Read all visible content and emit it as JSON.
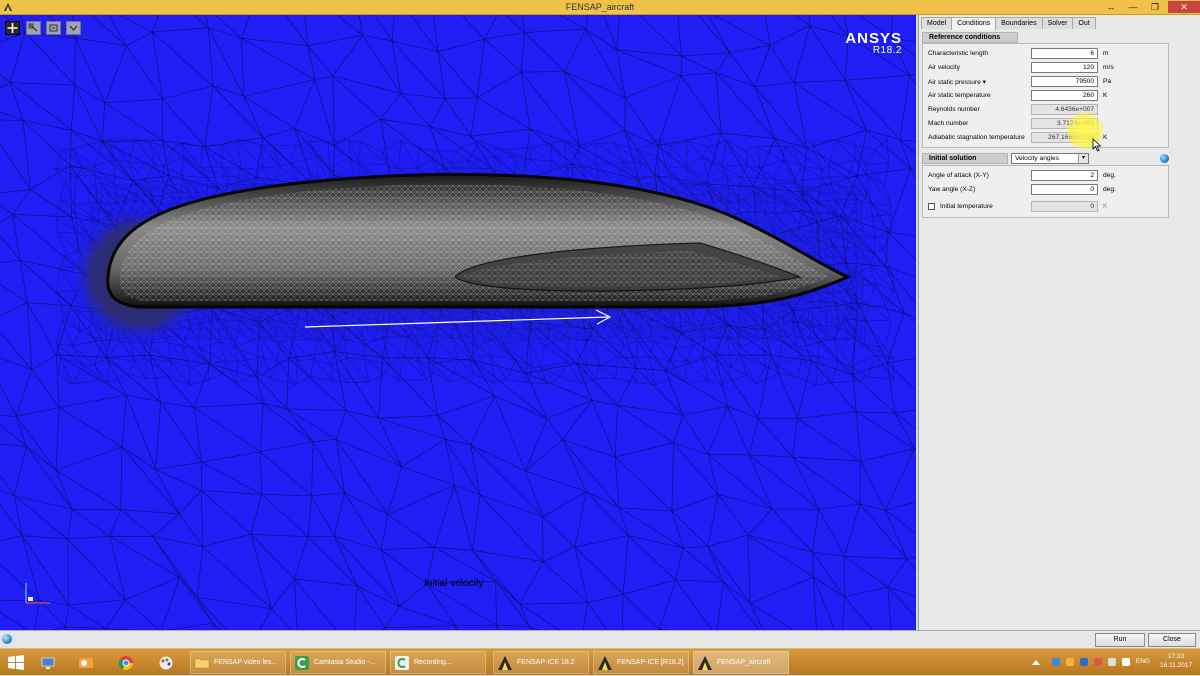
{
  "window": {
    "title": "FENSAP_aircraft",
    "controls": [
      "↔",
      "—",
      "❐",
      "✕"
    ]
  },
  "viewport": {
    "background_color": "#1e1ef5",
    "logo_brand": "ANSYS",
    "logo_version": "R18.2",
    "annotation": "Initial velocity",
    "tools": [
      "rotate-tool",
      "zoom-tool",
      "fit-tool",
      "view-menu-tool"
    ]
  },
  "panel": {
    "tabs": [
      {
        "label": "Model",
        "active": false
      },
      {
        "label": "Conditions",
        "active": true
      },
      {
        "label": "Boundaries",
        "active": false
      },
      {
        "label": "Solver",
        "active": false
      },
      {
        "label": "Out",
        "active": false
      }
    ],
    "reference": {
      "title": "Reference conditions",
      "rows": [
        {
          "label": "Characteristic length",
          "value": "6",
          "unit": "m",
          "readonly": false
        },
        {
          "label": "Air velocity",
          "value": "120",
          "unit": "m/s",
          "readonly": false
        },
        {
          "label": "Air static pressure ▾",
          "value": "79500",
          "unit": "Pa",
          "readonly": false
        },
        {
          "label": "Air static temperature",
          "value": "260",
          "unit": "K",
          "readonly": false
        },
        {
          "label": "Reynolds number",
          "value": "4.6436e+007",
          "unit": "",
          "readonly": true
        },
        {
          "label": "Mach number",
          "value": "3.7124e-001",
          "unit": "",
          "readonly": true
        },
        {
          "label": "Adiabatic stagnation temperature",
          "value": "267.166595155",
          "unit": "K",
          "readonly": true
        }
      ]
    },
    "initial": {
      "title": "Initial solution",
      "mode": "Velocity angles",
      "rows": [
        {
          "label": "Angle of attack (X-Y)",
          "value": "2",
          "unit": "deg.",
          "readonly": false
        },
        {
          "label": "Yaw angle (X-Z)",
          "value": "0",
          "unit": "deg.",
          "readonly": false
        }
      ],
      "temperature": {
        "label": "Initial temperature",
        "value": "0",
        "unit": "K",
        "checked": false
      }
    }
  },
  "buttons": {
    "run": "Run",
    "close": "Close"
  },
  "taskbar": {
    "items": [
      {
        "label": "FENSAP video les...",
        "icon_color": "#f5d36a"
      },
      {
        "label": "Camtasia Studio -...",
        "icon_color": "#3aa043"
      },
      {
        "label": "Recording...",
        "icon_color": "#3aa043"
      },
      {
        "label": "FENSAP-ICE 18.2",
        "icon_color": "#f2e24a"
      },
      {
        "label": "FENSAP-ICE [R18.2]",
        "icon_color": "#f2e24a"
      },
      {
        "label": "FENSAP_aircraft",
        "icon_color": "#f2e24a"
      }
    ],
    "language": "ENG",
    "time": "17:33",
    "date": "16.11.2017"
  }
}
